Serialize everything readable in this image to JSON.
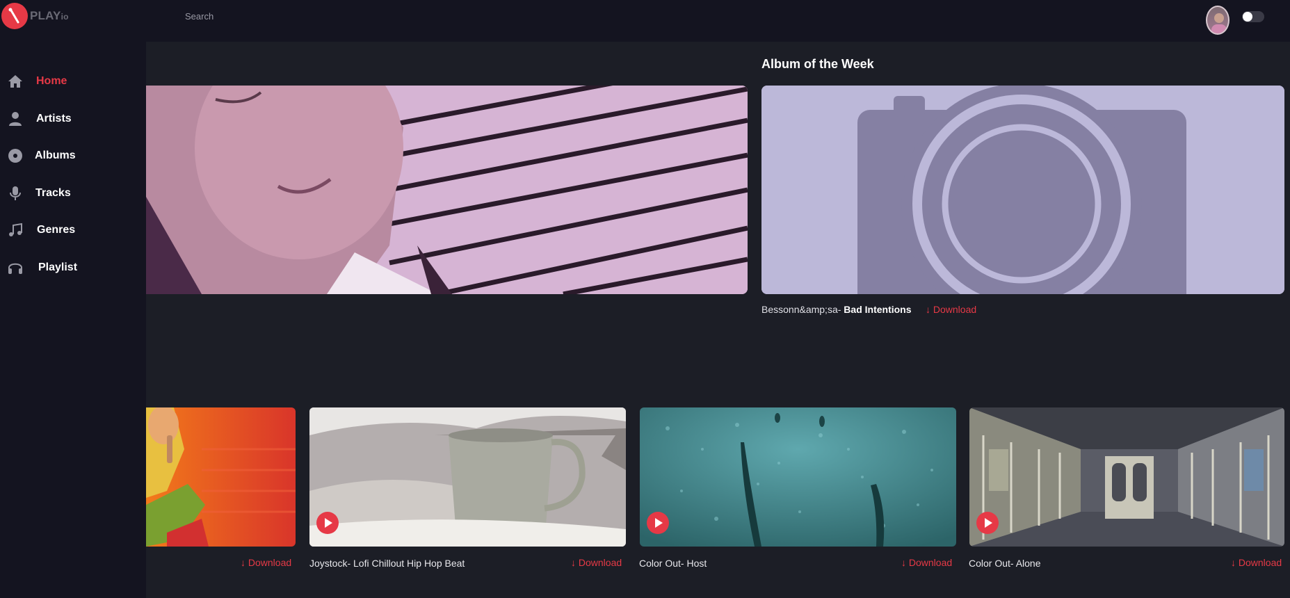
{
  "app": {
    "logo_main": "PLAY",
    "logo_suffix": "io"
  },
  "header": {
    "search_placeholder": "Search"
  },
  "sidebar": {
    "items": [
      {
        "label": "Home",
        "icon": "home-icon",
        "active": true
      },
      {
        "label": "Artists",
        "icon": "user-icon"
      },
      {
        "label": "Albums",
        "icon": "disc-icon"
      },
      {
        "label": "Tracks",
        "icon": "microphone-icon"
      },
      {
        "label": "Genres",
        "icon": "music-note-icon"
      },
      {
        "label": "Playlist",
        "icon": "headphones-icon"
      }
    ]
  },
  "featured": {
    "section_title": "Album of the Week",
    "artist": "Bessonn&amp;sa-",
    "title": "Bad Intentions",
    "download_label": "↓ Download"
  },
  "tracks": [
    {
      "title": "",
      "download_label": "↓ Download"
    },
    {
      "title": "Joystock- Lofi Chillout Hip Hop Beat",
      "download_label": "↓ Download"
    },
    {
      "title": "Color Out- Host",
      "download_label": "↓ Download"
    },
    {
      "title": "Color Out- Alone",
      "download_label": "↓ Download"
    }
  ],
  "colors": {
    "accent": "#e63946",
    "background": "#1c1e26",
    "sidebar": "#141420"
  }
}
